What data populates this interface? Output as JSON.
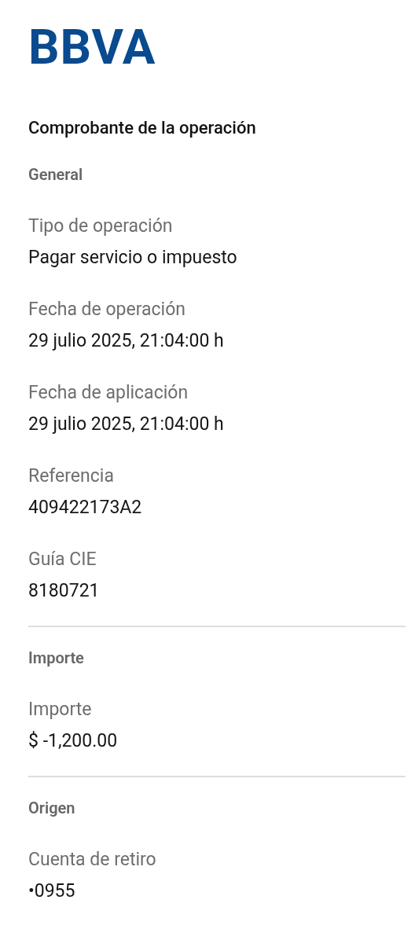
{
  "logo": {
    "text": "BBVA"
  },
  "title": "Comprobante de la operación",
  "sections": [
    {
      "title": "General",
      "fields": [
        {
          "label": "Tipo de operación",
          "value": "Pagar servicio o impuesto"
        },
        {
          "label": "Fecha de operación",
          "value": "29 julio 2025, 21:04:00 h"
        },
        {
          "label": "Fecha de aplicación",
          "value": "29 julio 2025, 21:04:00 h"
        },
        {
          "label": "Referencia",
          "value": "409422173A2"
        },
        {
          "label": "Guía CIE",
          "value": "8180721"
        }
      ]
    },
    {
      "title": "Importe",
      "fields": [
        {
          "label": "Importe",
          "value": "$ -1,200.00"
        }
      ]
    },
    {
      "title": "Origen",
      "fields": [
        {
          "label": "Cuenta de retiro",
          "value": "•0955"
        }
      ]
    }
  ]
}
